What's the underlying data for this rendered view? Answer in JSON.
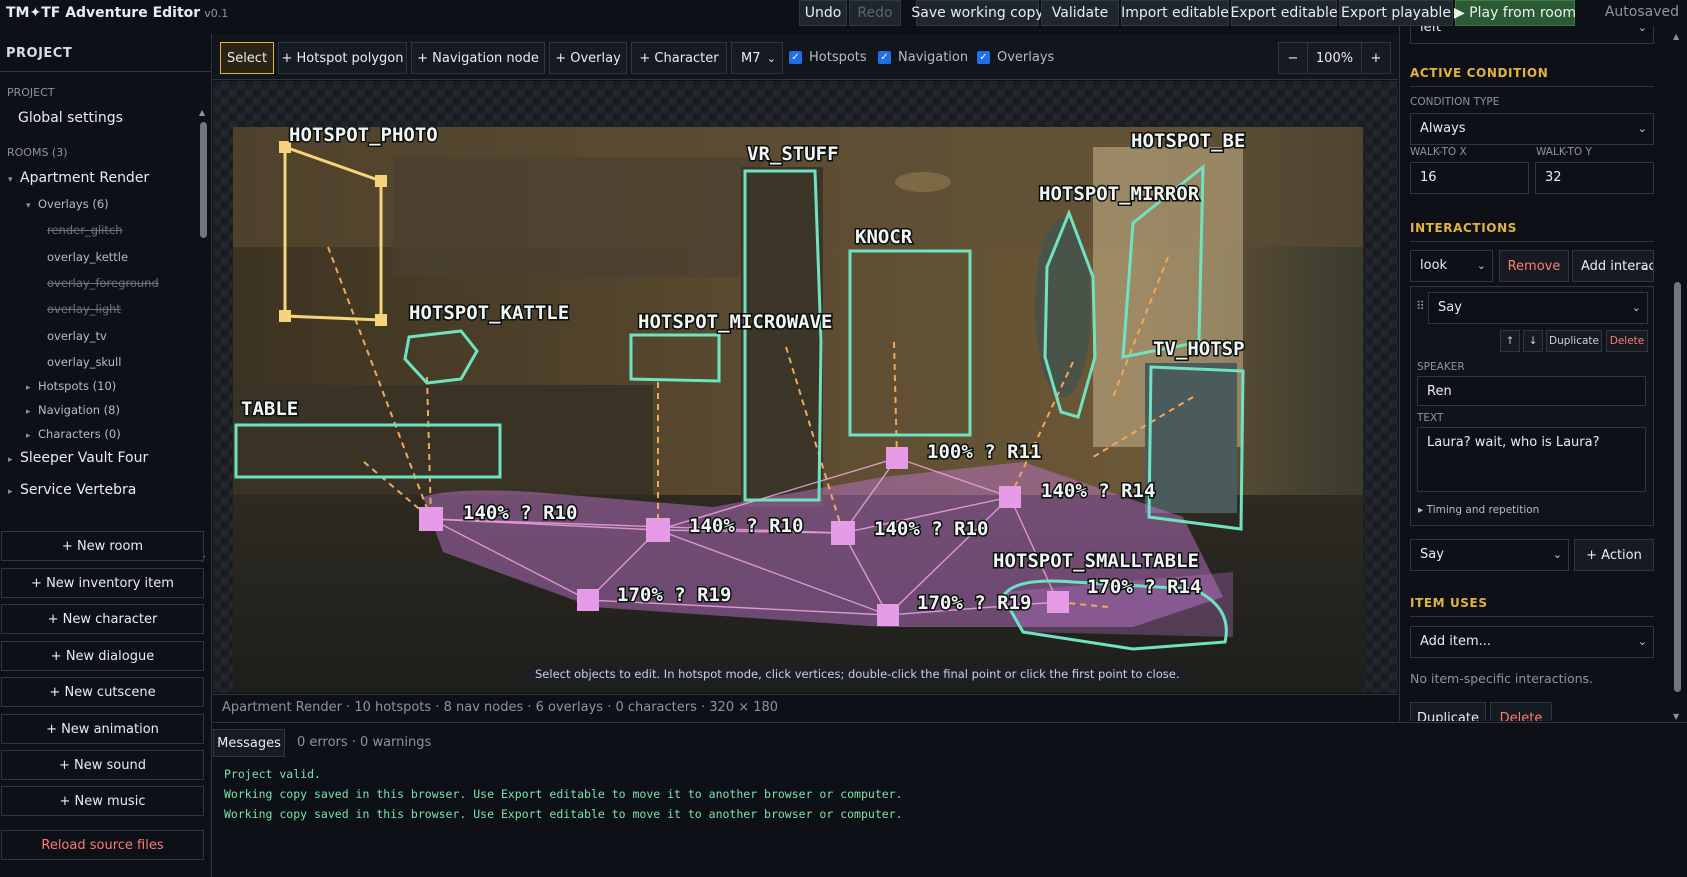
{
  "app": {
    "title": "TM✦TF Adventure Editor",
    "version": "v0.1",
    "autosave_status": "Autosaved"
  },
  "toolbar": {
    "undo": "Undo",
    "redo": "Redo",
    "save_working_copy": "Save working copy",
    "validate": "Validate",
    "import_editable": "Import editable",
    "export_editable": "Export editable",
    "export_playable": "Export playable",
    "play_from_room": "▶ Play from room"
  },
  "sidebar": {
    "header": "PROJECT",
    "project_section": "PROJECT",
    "global_settings": "Global settings",
    "rooms_section": "ROOMS (3)",
    "rooms": [
      {
        "name": "Apartment Render",
        "expanded": true
      },
      {
        "name": "Sleeper Vault Four",
        "expanded": false
      },
      {
        "name": "Service Vertebra",
        "expanded": false
      }
    ],
    "overlays_group": "Overlays (6)",
    "overlays": [
      {
        "name": "render_glitch",
        "hidden": true
      },
      {
        "name": "overlay_kettle",
        "hidden": false
      },
      {
        "name": "overlay_foreground",
        "hidden": true
      },
      {
        "name": "overlay_light",
        "hidden": true
      },
      {
        "name": "overlay_tv",
        "hidden": false
      },
      {
        "name": "overlay_skull",
        "hidden": false
      }
    ],
    "groups": [
      "Hotspots (10)",
      "Navigation (8)",
      "Characters (0)"
    ],
    "buttons": [
      "+ New room",
      "+ New inventory item",
      "+ New character",
      "+ New dialogue",
      "+ New cutscene",
      "+ New animation",
      "+ New sound",
      "+ New music"
    ],
    "reload": "Reload source files"
  },
  "canvas_toolbar": {
    "tools": [
      "Select",
      "+ Hotspot polygon",
      "+ Navigation node",
      "+ Overlay",
      "+ Character"
    ],
    "active_tool": "Select",
    "zoom_select": "M7",
    "toggles": [
      {
        "label": "Hotspots",
        "checked": true
      },
      {
        "label": "Navigation",
        "checked": true
      },
      {
        "label": "Overlays",
        "checked": true
      }
    ],
    "zoom_out": "−",
    "zoom_level": "100%",
    "zoom_in": "+"
  },
  "scene": {
    "hotspot_labels": [
      "HOTSPOT_PHOTO",
      "VR_STUFF",
      "HOTSPOT_BE",
      "HOTSPOT_MIRROR",
      "KNOCR",
      "HOTSPOT_KATTLE",
      "HOTSPOT_MICROWAVE",
      "TV_HOTSP",
      "TABLE",
      "HOTSPOT_SMALLTABLE"
    ],
    "nav_labels": [
      "100% ? R11",
      "140% ? R14",
      "140% ? R10",
      "140% ? R10",
      "140% ? R10",
      "170% ? R19",
      "170% ? R19",
      "170% ? R14"
    ],
    "colors": {
      "hotspot": "#6fe3c1",
      "selected": "#f6d47a",
      "nav": "#e59be8",
      "nav_link": "#f1a4e6",
      "dash": "#f2a85a"
    },
    "hint": "Select objects to edit. In hotspot mode, click vertices; double-click the final point or click the first point to close."
  },
  "status_bar": "Apartment Render · 10 hotspots · 8 nav nodes · 6 overlays · 0 characters · 320 × 180",
  "messages": {
    "tab": "Messages",
    "counts": "0 errors · 0 warnings",
    "lines": [
      "Project valid.",
      "Working copy saved in this browser. Use Export editable to move it to another browser or computer.",
      "Working copy saved in this browser. Use Export editable to move it to another browser or computer."
    ]
  },
  "right_panel": {
    "top_select": "left",
    "active_condition": {
      "heading": "ACTIVE CONDITION",
      "condition_type_label": "CONDITION TYPE",
      "condition_type": "Always",
      "walk_to_x_label": "WALK-TO X",
      "walk_to_x": "16",
      "walk_to_y_label": "WALK-TO Y",
      "walk_to_y": "32"
    },
    "interactions": {
      "heading": "INTERACTIONS",
      "verb": "look",
      "remove": "Remove",
      "add": "Add interact",
      "action_type": "Say",
      "up": "↑",
      "down": "↓",
      "duplicate": "Duplicate",
      "delete": "Delete",
      "speaker_label": "SPEAKER",
      "speaker": "Ren",
      "text_label": "TEXT",
      "text": "Laura? wait, who is Laura?",
      "timing": "▸ Timing and repetition",
      "new_action_type": "Say",
      "add_action": "+ Action"
    },
    "item_uses": {
      "heading": "ITEM USES",
      "add_item": "Add item...",
      "empty": "No item-specific interactions.",
      "duplicate": "Duplicate",
      "delete": "Delete"
    }
  }
}
